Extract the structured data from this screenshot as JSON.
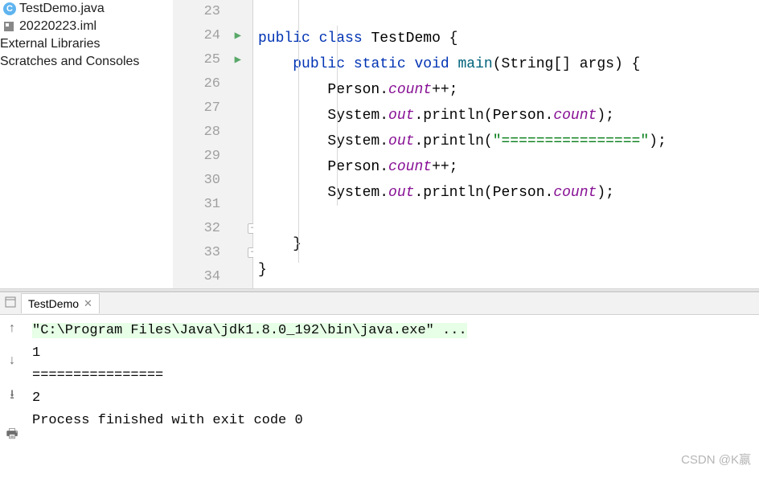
{
  "sidebar": {
    "items": [
      {
        "label": "TestDemo.java",
        "icon": "C"
      },
      {
        "label": "20220223.iml",
        "icon": "iml"
      },
      {
        "label": "External Libraries"
      },
      {
        "label": "Scratches and Consoles"
      }
    ]
  },
  "editor": {
    "lineNumbers": [
      "23",
      "24",
      "25",
      "26",
      "27",
      "28",
      "29",
      "30",
      "31",
      "32",
      "33",
      "34"
    ],
    "code": {
      "l24": {
        "kw1": "public",
        "kw2": "class",
        "cls": "TestDemo",
        "tail": " {"
      },
      "l25": {
        "kw1": "public",
        "kw2": "static",
        "kw3": "void",
        "method": "main",
        "params": "(String[] args) {"
      },
      "l26": {
        "cls": "Person",
        "dot": ".",
        "field": "count",
        "tail": "++;"
      },
      "l27": {
        "sys": "System.",
        "out": "out",
        "dot": ".",
        "fn": "println",
        "open": "(",
        "cls": "Person",
        "dot2": ".",
        "field": "count",
        "close": ");"
      },
      "l28": {
        "sys": "System.",
        "out": "out",
        "dot": ".",
        "fn": "println",
        "open": "(",
        "str": "\"================\"",
        "close": ");"
      },
      "l29": {
        "cls": "Person",
        "dot": ".",
        "field": "count",
        "tail": "++;"
      },
      "l30": {
        "sys": "System.",
        "out": "out",
        "dot": ".",
        "fn": "println",
        "open": "(",
        "cls": "Person",
        "dot2": ".",
        "field": "count",
        "close": ");"
      },
      "l32": "    }",
      "l33": "}"
    }
  },
  "console": {
    "tabLabel": "TestDemo",
    "lines": {
      "cmd": "\"C:\\Program Files\\Java\\jdk1.8.0_192\\bin\\java.exe\" ...",
      "out1": "1",
      "out2": "================",
      "out3": "2",
      "blank": "",
      "exit": "Process finished with exit code 0"
    }
  },
  "watermark": "CSDN @K嬴"
}
